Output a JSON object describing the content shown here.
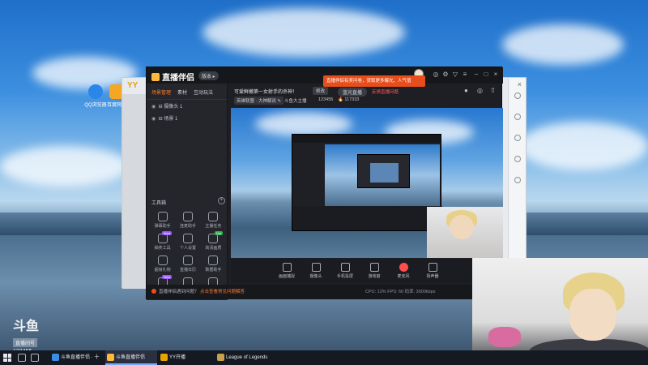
{
  "desktop": {
    "icons": [
      {
        "label": "QQ浏览器",
        "color": "#2a86e8"
      },
      {
        "label": "百度网盘",
        "color": "#f5a623"
      }
    ]
  },
  "yy_window": {
    "logo": "YY",
    "close": "×"
  },
  "app": {
    "brand": "直播伴侣",
    "version": "版本 ▸",
    "promo": "直播伴侣有奖问卷，获取更多曝光、人气值",
    "window_controls": [
      "◎",
      "⚙",
      "▽",
      "≡",
      "–",
      "□",
      "×"
    ],
    "panel_tabs": [
      "场景管理",
      "素材",
      "互动玩法"
    ],
    "scenes": [
      {
        "eye": "◉",
        "label": "⊟ 摄像头 1"
      },
      {
        "eye": "◉",
        "label": "⊟ 场景 1"
      }
    ],
    "tools_title": "工具箱",
    "tools_add": "+",
    "tools": [
      {
        "label": "弹幕助手",
        "tag": ""
      },
      {
        "label": "连麦助手",
        "tag": ""
      },
      {
        "label": "主播任务",
        "tag": ""
      },
      {
        "label": "抽奖工具",
        "tag": "New"
      },
      {
        "label": "个人设置",
        "tag": ""
      },
      {
        "label": "高清画质",
        "tag": "Hot"
      },
      {
        "label": "超级礼物",
        "tag": ""
      },
      {
        "label": "直播日历",
        "tag": ""
      },
      {
        "label": "数据助手",
        "tag": ""
      },
      {
        "label": "一键开播",
        "tag": "New"
      },
      {
        "label": "本地录制",
        "tag": ""
      },
      {
        "label": "更多",
        "tag": ""
      }
    ],
    "stream": {
      "title": "可爱鲜嫩第一女射手的杀神！",
      "edit": "修改",
      "quality": "蓝光直播",
      "feedback": "反馈直播问题",
      "right_icons": [
        "●",
        "◎",
        "⇧"
      ],
      "category": "英雄联盟 · 大神解说 ✎",
      "room_name": "斗鱼大主播",
      "room_id": "123455",
      "heat": "🔥 117333"
    },
    "toolbar": [
      {
        "label": "画面捕捉",
        "style": "normal"
      },
      {
        "label": "摄像头",
        "style": "normal"
      },
      {
        "label": "手机投屏",
        "style": "normal"
      },
      {
        "label": "游戏窗",
        "style": "normal"
      },
      {
        "label": "麦克风",
        "style": "red"
      },
      {
        "label": "扬声器",
        "style": "normal"
      }
    ],
    "status": {
      "message": "直播伴侣遇到问题？",
      "link": "点击查看常见问题解答",
      "stats": "CPU: 12%   FPS: 60   码率: 3000kbps"
    }
  },
  "watermark": {
    "logo": "斗鱼",
    "sub": "直播间号",
    "number": "123455"
  },
  "taskbar": {
    "tasks": [
      {
        "label": "斗鱼直播伴侣 · 十周...",
        "color": "#3a8ee6",
        "active": false
      },
      {
        "label": "斗鱼直播伴侣",
        "color": "#ffb83b",
        "active": true
      },
      {
        "label": "YY开播",
        "color": "#e8a400",
        "active": false
      },
      {
        "label": "League of Legends",
        "color": "#c8a14a",
        "active": false
      }
    ]
  }
}
